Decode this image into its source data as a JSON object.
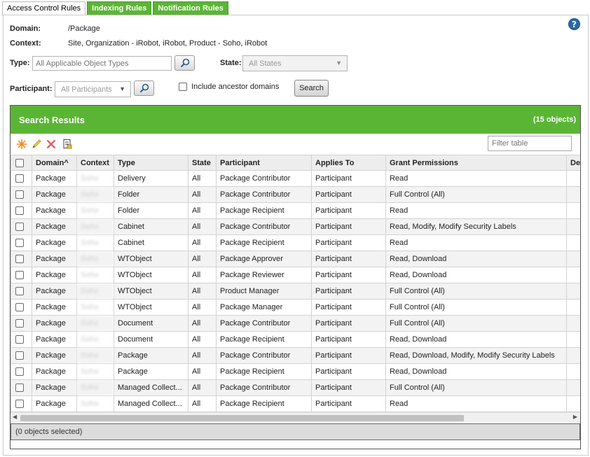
{
  "tabs": [
    {
      "label": "Access Control Rules",
      "active": true
    },
    {
      "label": "Indexing Rules",
      "active": false
    },
    {
      "label": "Notification Rules",
      "active": false
    }
  ],
  "help_icon": "help-question-icon",
  "info": {
    "domain_label": "Domain:",
    "domain_value": "/Package",
    "context_label": "Context:",
    "context_value": "Site, Organization - iRobot, iRobot, Product - Soho, iRobot"
  },
  "filters": {
    "type_label": "Type:",
    "type_placeholder": "All Applicable Object Types",
    "state_label": "State:",
    "state_value": "All States",
    "participant_label": "Participant:",
    "participant_value": "All Participants",
    "include_ancestor_label": "Include ancestor domains",
    "search_label": "Search"
  },
  "results": {
    "title": "Search Results",
    "count": "(15 objects)",
    "filter_placeholder": "Filter table",
    "toolbar_icons": [
      "new-rule-icon",
      "edit-pencil-icon",
      "delete-x-icon",
      "export-list-icon"
    ],
    "columns": [
      "",
      "Domain^",
      "Context",
      "Type",
      "State",
      "Participant",
      "Applies To",
      "Grant Permissions",
      "De"
    ],
    "rows": [
      {
        "domain": "Package",
        "context": "Soho",
        "type": "Delivery",
        "state": "All",
        "participant": "Package Contributor",
        "applies_to": "Participant",
        "permissions": "Read"
      },
      {
        "domain": "Package",
        "context": "Soho",
        "type": "Folder",
        "state": "All",
        "participant": "Package Contributor",
        "applies_to": "Participant",
        "permissions": "Full Control (All)"
      },
      {
        "domain": "Package",
        "context": "Soho",
        "type": "Folder",
        "state": "All",
        "participant": "Package Recipient",
        "applies_to": "Participant",
        "permissions": "Read"
      },
      {
        "domain": "Package",
        "context": "Soho",
        "type": "Cabinet",
        "state": "All",
        "participant": "Package Contributor",
        "applies_to": "Participant",
        "permissions": "Read, Modify, Modify Security Labels"
      },
      {
        "domain": "Package",
        "context": "Soho",
        "type": "Cabinet",
        "state": "All",
        "participant": "Package Recipient",
        "applies_to": "Participant",
        "permissions": "Read"
      },
      {
        "domain": "Package",
        "context": "Soho",
        "type": "WTObject",
        "state": "All",
        "participant": "Package Approver",
        "applies_to": "Participant",
        "permissions": "Read, Download"
      },
      {
        "domain": "Package",
        "context": "Soho",
        "type": "WTObject",
        "state": "All",
        "participant": "Package Reviewer",
        "applies_to": "Participant",
        "permissions": "Read, Download"
      },
      {
        "domain": "Package",
        "context": "Soho",
        "type": "WTObject",
        "state": "All",
        "participant": "Product Manager",
        "applies_to": "Participant",
        "permissions": "Full Control (All)"
      },
      {
        "domain": "Package",
        "context": "Soho",
        "type": "WTObject",
        "state": "All",
        "participant": "Package Manager",
        "applies_to": "Participant",
        "permissions": "Full Control (All)"
      },
      {
        "domain": "Package",
        "context": "Soho",
        "type": "Document",
        "state": "All",
        "participant": "Package Contributor",
        "applies_to": "Participant",
        "permissions": "Full Control (All)"
      },
      {
        "domain": "Package",
        "context": "Soho",
        "type": "Document",
        "state": "All",
        "participant": "Package Recipient",
        "applies_to": "Participant",
        "permissions": "Read, Download"
      },
      {
        "domain": "Package",
        "context": "Soho",
        "type": "Package",
        "state": "All",
        "participant": "Package Contributor",
        "applies_to": "Participant",
        "permissions": "Read, Download, Modify, Modify Security Labels"
      },
      {
        "domain": "Package",
        "context": "Soho",
        "type": "Package",
        "state": "All",
        "participant": "Package Recipient",
        "applies_to": "Participant",
        "permissions": "Read, Download"
      },
      {
        "domain": "Package",
        "context": "Soho",
        "type": "Managed Collect...",
        "state": "All",
        "participant": "Package Contributor",
        "applies_to": "Participant",
        "permissions": "Full Control (All)"
      },
      {
        "domain": "Package",
        "context": "Soho",
        "type": "Managed Collect...",
        "state": "All",
        "participant": "Package Recipient",
        "applies_to": "Participant",
        "permissions": "Read"
      }
    ],
    "selection_status": "(0 objects selected)"
  },
  "colors": {
    "accent_green": "#5bb535",
    "header_gray": "#ededed",
    "help_blue": "#2b6aa6"
  }
}
